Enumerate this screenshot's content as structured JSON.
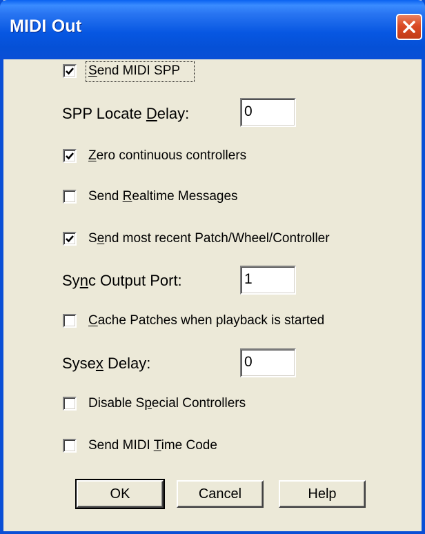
{
  "window": {
    "title": "MIDI Out"
  },
  "options": {
    "send_midi_spp": {
      "label_pre": "",
      "label_key": "S",
      "label_post": "end MIDI SPP",
      "checked": true
    },
    "zero_controllers": {
      "label_pre": "",
      "label_key": "Z",
      "label_post": "ero continuous controllers",
      "checked": true
    },
    "send_realtime": {
      "label_pre": "Send ",
      "label_key": "R",
      "label_post": "ealtime Messages",
      "checked": false
    },
    "send_recent_patch": {
      "label_pre": "S",
      "label_key": "e",
      "label_post": "nd most recent Patch/Wheel/Controller",
      "checked": true
    },
    "cache_patches": {
      "label_pre": "",
      "label_key": "C",
      "label_post": "ache Patches when playback is started",
      "checked": false
    },
    "disable_special": {
      "label_pre": "Disable S",
      "label_key": "p",
      "label_post": "ecial Controllers",
      "checked": false
    },
    "send_mtc": {
      "label_pre": "Send MIDI ",
      "label_key": "T",
      "label_post": "ime Code",
      "checked": false
    }
  },
  "fields": {
    "spp_locate_delay": {
      "label_pre": "SPP Locate ",
      "label_key": "D",
      "label_post": "elay:",
      "value": "0"
    },
    "sync_output_port": {
      "label_pre": "Sy",
      "label_key": "n",
      "label_post": "c Output Port:",
      "value": "1"
    },
    "sysex_delay": {
      "label_pre": "Syse",
      "label_key": "x",
      "label_post": " Delay:",
      "value": "0"
    }
  },
  "buttons": {
    "ok": "OK",
    "cancel": "Cancel",
    "help": "Help"
  },
  "colors": {
    "title_bar": "#0a4fd6",
    "dialog_bg": "#ece9d8",
    "close_button": "#db4a25"
  },
  "icons": {
    "close": "close-icon",
    "check": "checkmark-icon"
  }
}
